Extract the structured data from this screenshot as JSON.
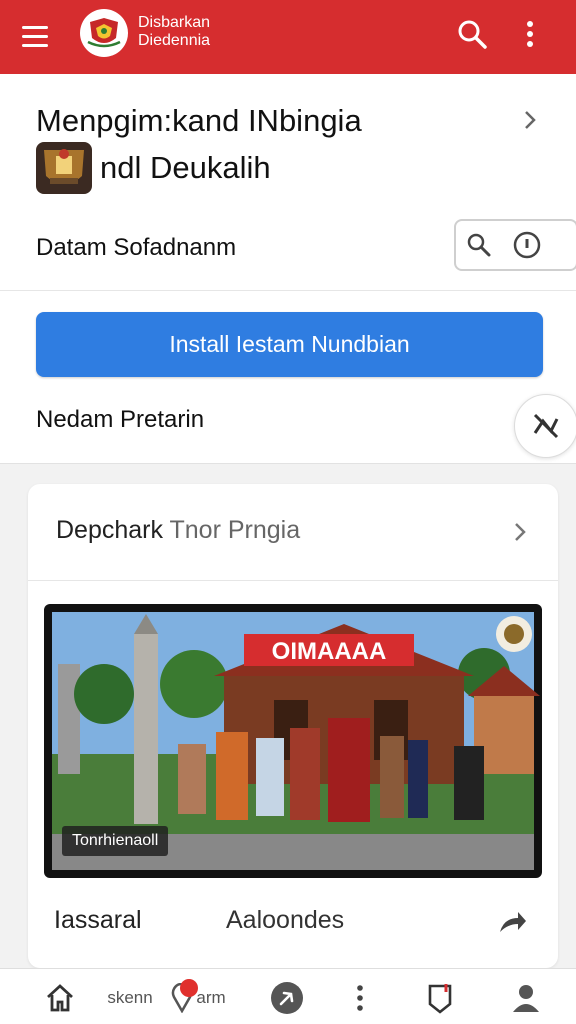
{
  "appbar": {
    "brand_line1": "Disbarkan",
    "brand_line2": "Diedennia",
    "color": "#d62d2f",
    "icons": [
      "menu-icon",
      "search-icon",
      "more-vert-icon"
    ]
  },
  "main": {
    "headline_line1": "Menpgim:kand INbingia",
    "headline_line2": "ndl Deukalih",
    "row_label": "Datam Sofadnanm",
    "install_label": "Install Iestam Nundbian",
    "secondary_label": "Nedam Pretarin",
    "accent": "#2f7de1"
  },
  "card": {
    "title_dark": "Depchark",
    "title_muted": "Tnor Prngia",
    "banner_text": "OIMAAAA",
    "photo_caption": "Tonrhienaoll",
    "footer_left": "Iassaral",
    "footer_mid": "Aaloondes"
  },
  "bottom_nav": {
    "item2_text": "skenn",
    "item3_text": "arm",
    "icons": [
      "home-icon",
      "location-icon",
      "compass-icon",
      "more-vert-icon",
      "bookmark-icon",
      "profile-icon"
    ]
  }
}
